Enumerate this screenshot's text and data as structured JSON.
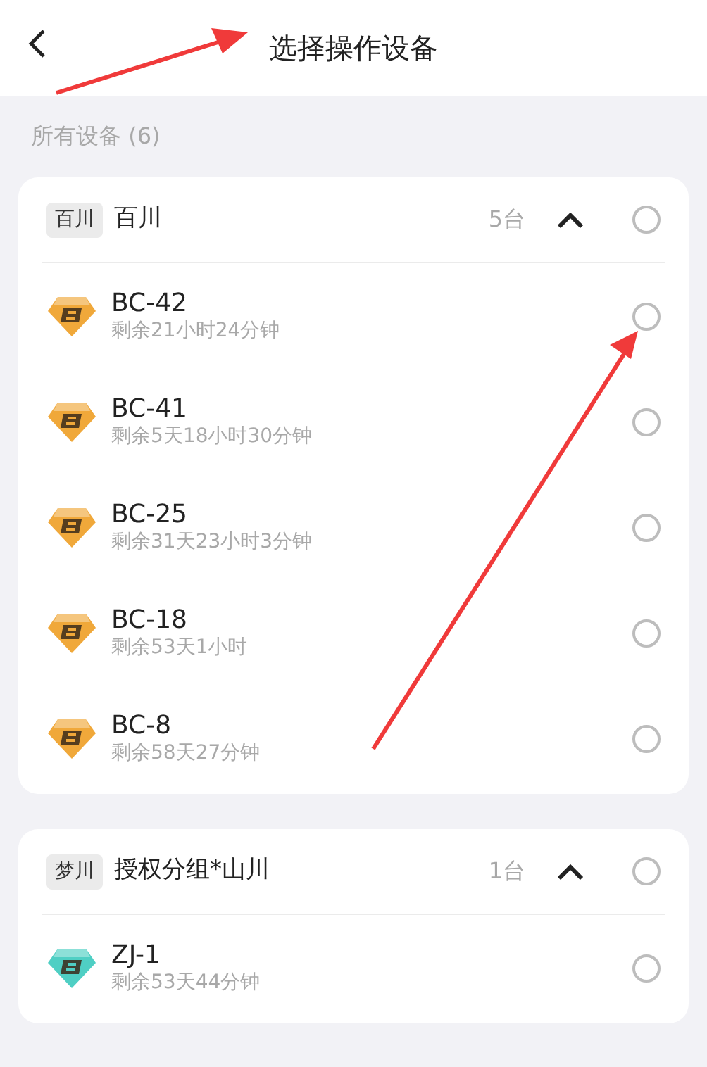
{
  "header": {
    "title": "选择操作设备"
  },
  "summary": "所有设备 (6)",
  "groups": [
    {
      "tag": "百川",
      "name": "百川",
      "count": "5台",
      "expanded": true,
      "selected": false,
      "devices": [
        {
          "name": "BC-42",
          "remaining": "剩余21小时24分钟",
          "color": "#f0a83a",
          "selected": false
        },
        {
          "name": "BC-41",
          "remaining": "剩余5天18小时30分钟",
          "color": "#f0a83a",
          "selected": false
        },
        {
          "name": "BC-25",
          "remaining": "剩余31天23小时3分钟",
          "color": "#f0a83a",
          "selected": false
        },
        {
          "name": "BC-18",
          "remaining": "剩余53天1小时",
          "color": "#f0a83a",
          "selected": false
        },
        {
          "name": "BC-8",
          "remaining": "剩余58天27分钟",
          "color": "#f0a83a",
          "selected": false
        }
      ]
    },
    {
      "tag": "梦川",
      "name": "授权分组*山川",
      "count": "1台",
      "expanded": true,
      "selected": false,
      "devices": [
        {
          "name": "ZJ-1",
          "remaining": "剩余53天44分钟",
          "color": "#4fcfc4",
          "selected": false
        }
      ]
    }
  ]
}
